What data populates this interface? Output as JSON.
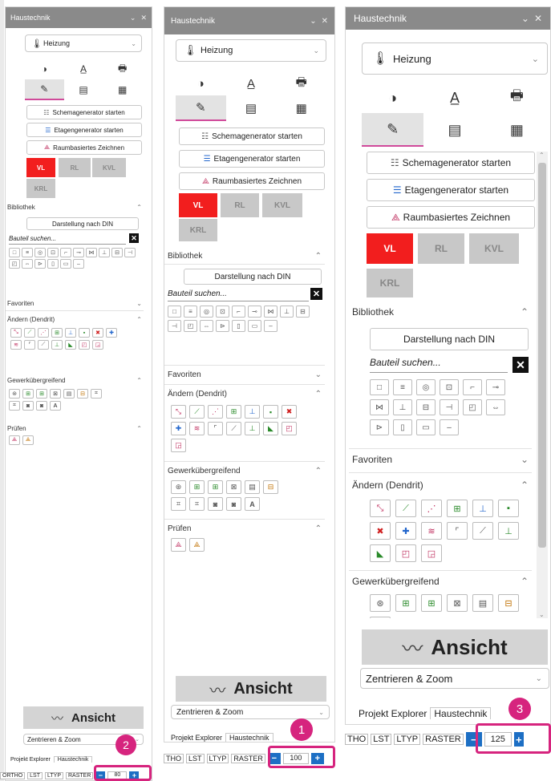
{
  "title": "Haustechnik",
  "window_controls": {
    "collapse": "⌄",
    "close": "✕"
  },
  "select_value": "Heizung",
  "buttons": {
    "schema": "Schemagenerator starten",
    "etage": "Etagengenerator starten",
    "raum": "Raumbasiertes Zeichnen",
    "din": "Darstellung nach DIN"
  },
  "pills": {
    "vl": "VL",
    "rl": "RL",
    "kvl": "KVL",
    "krl": "KRL"
  },
  "sections": {
    "bibliothek": "Bibliothek",
    "favoriten": "Favoriten",
    "aendern": "Ändern (Dendrit)",
    "gewerk": "Gewerkübergreifend",
    "pruefen": "Prüfen"
  },
  "search_placeholder": "Bauteil suchen...",
  "ansicht": "Ansicht",
  "zentrieren": "Zentrieren & Zoom",
  "bottom_tabs": {
    "explorer": "Projekt Explorer",
    "haustechnik": "Haustechnik"
  },
  "status": {
    "p1": [
      "THO",
      "LST",
      "LTYP",
      "RASTER"
    ],
    "p2": [
      "ORTHO",
      "LST",
      "LTYP",
      "RASTER"
    ],
    "p3": [
      "THO",
      "LST",
      "LTYP",
      "RASTER"
    ]
  },
  "zoom": {
    "p1": "100",
    "p2": "80",
    "p3": "125"
  },
  "badges": {
    "b1": "1",
    "b2": "2",
    "b3": "3"
  }
}
